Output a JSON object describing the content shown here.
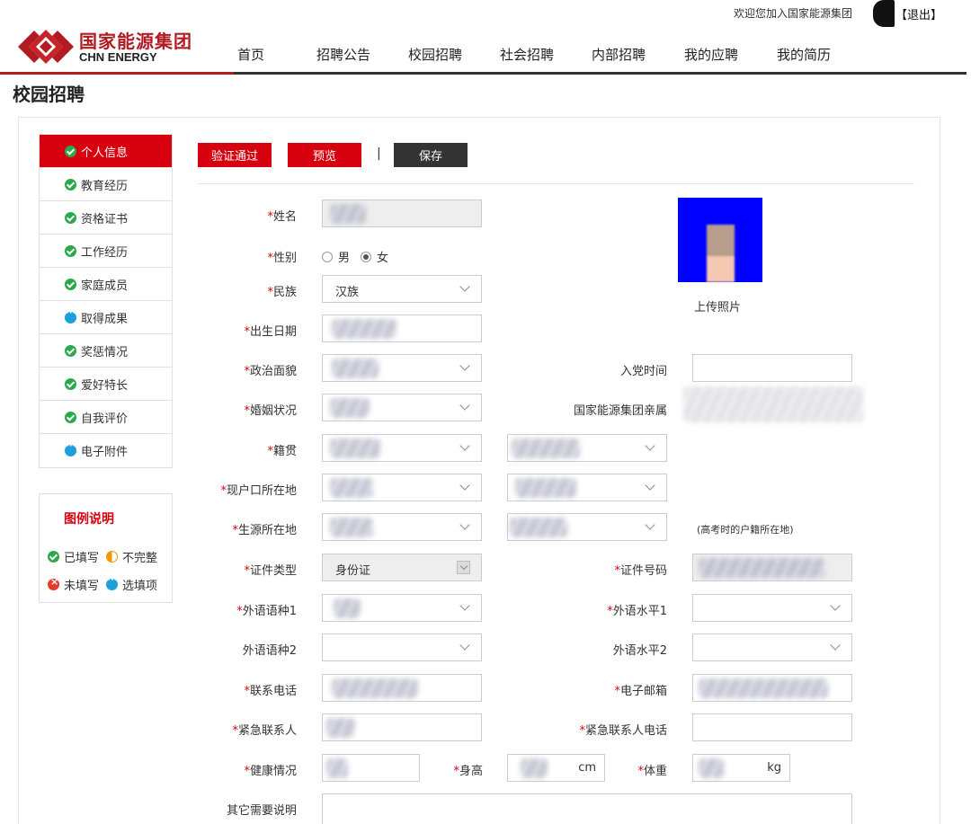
{
  "header": {
    "welcome": "欢迎您加入国家能源集团",
    "logout": "【退出】",
    "logo_cn": "国家能源集团",
    "logo_en": "CHN ENERGY"
  },
  "nav": [
    "首页",
    "招聘公告",
    "校园招聘",
    "社会招聘",
    "内部招聘",
    "我的应聘",
    "我的简历"
  ],
  "page_title": "校园招聘",
  "sidebar": [
    {
      "label": "个人信息",
      "status": "filled"
    },
    {
      "label": "教育经历",
      "status": "filled"
    },
    {
      "label": "资格证书",
      "status": "filled"
    },
    {
      "label": "工作经历",
      "status": "filled"
    },
    {
      "label": "家庭成员",
      "status": "filled"
    },
    {
      "label": "取得成果",
      "status": "optional"
    },
    {
      "label": "奖惩情况",
      "status": "filled"
    },
    {
      "label": "爱好特长",
      "status": "filled"
    },
    {
      "label": "自我评价",
      "status": "filled"
    },
    {
      "label": "电子附件",
      "status": "optional"
    }
  ],
  "legend": {
    "title": "图例说明",
    "filled": "已填写",
    "incomplete": "不完整",
    "unfilled": "未填写",
    "optional": "选填项"
  },
  "actions": {
    "verify": "验证通过",
    "preview": "预览",
    "separator": "|",
    "save": "保存"
  },
  "form": {
    "name": "姓名",
    "gender": "性别",
    "gender_male": "男",
    "gender_female": "女",
    "ethnicity": "民族",
    "ethnicity_value": "汉族",
    "birth_date": "出生日期",
    "political_status": "政治面貌",
    "party_join_date": "入党时间",
    "marital_status": "婚姻状况",
    "relative": "国家能源集团亲属",
    "native_place": "籍贯",
    "hukou": "现户口所在地",
    "student_origin": "生源所在地",
    "origin_note": "(高考时的户籍所在地)",
    "id_type": "证件类型",
    "id_type_value": "身份证",
    "id_number": "证件号码",
    "lang1": "外语语种1",
    "lang_level1": "外语水平1",
    "lang2": "外语语种2",
    "lang_level2": "外语水平2",
    "phone": "联系电话",
    "email": "电子邮箱",
    "emergency_contact": "紧急联系人",
    "emergency_phone": "紧急联系人电话",
    "health": "健康情况",
    "height": "身高",
    "height_unit": "cm",
    "weight": "体重",
    "weight_unit": "kg",
    "other": "其它需要说明",
    "req_mark": "*"
  },
  "photo": {
    "upload_label": "上传照片"
  },
  "colors": {
    "brand_red": "#d7000f",
    "logo_red": "#b01c22",
    "filled_green": "#2ba84a",
    "optional_blue": "#1ba0dc",
    "incomplete_orange": "#f39800",
    "unfilled_red": "#e43a2f"
  }
}
